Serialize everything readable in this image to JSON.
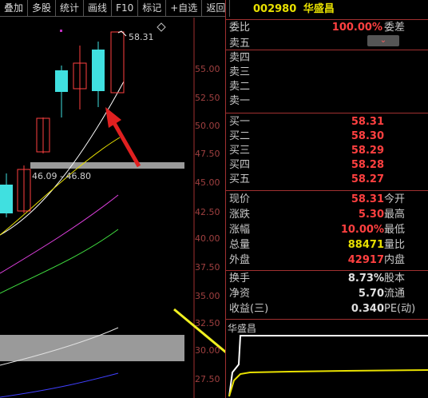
{
  "toolbar": {
    "items": [
      "叠加",
      "多股",
      "统计",
      "画线",
      "F10",
      "标记",
      "+自选",
      "返回"
    ]
  },
  "chart": {
    "price_axis": [
      "55.00",
      "52.50",
      "50.00",
      "47.50",
      "45.00",
      "42.50",
      "40.00",
      "37.50",
      "35.00",
      "32.50",
      "30.00",
      "27.50"
    ],
    "high_label": "58.31",
    "range_label": "46.09 - 46.80"
  },
  "stock": {
    "code": "002980",
    "name": "华盛昌"
  },
  "weibi": {
    "label": "委比",
    "value": "100.00%",
    "label2": "委差"
  },
  "asks": [
    {
      "label": "卖五",
      "price": ""
    },
    {
      "label": "卖四",
      "price": ""
    },
    {
      "label": "卖三",
      "price": ""
    },
    {
      "label": "卖二",
      "price": ""
    },
    {
      "label": "卖一",
      "price": ""
    }
  ],
  "bids": [
    {
      "label": "买一",
      "price": "58.31"
    },
    {
      "label": "买二",
      "price": "58.30"
    },
    {
      "label": "买三",
      "price": "58.29"
    },
    {
      "label": "买四",
      "price": "58.28"
    },
    {
      "label": "买五",
      "price": "58.27"
    }
  ],
  "quote": [
    {
      "label": "现价",
      "value": "58.31",
      "label2": "今开"
    },
    {
      "label": "涨跌",
      "value": "5.30",
      "label2": "最高"
    },
    {
      "label": "涨幅",
      "value": "10.00%",
      "label2": "最低"
    },
    {
      "label": "总量",
      "value": "88471",
      "label2": "量比"
    },
    {
      "label": "外盘",
      "value": "42917",
      "label2": "内盘"
    }
  ],
  "finance": [
    {
      "label": "换手",
      "value": "8.73%",
      "label2": "股本"
    },
    {
      "label": "净资",
      "value": "5.70",
      "label2": "流通"
    },
    {
      "label": "收益(三)",
      "value": "0.340",
      "label2": "PE(动)"
    }
  ],
  "mini": {
    "title": "华盛昌"
  },
  "colors": {
    "up": "#ff4040",
    "down": "#40e0e0",
    "accent": "#e8e000"
  }
}
